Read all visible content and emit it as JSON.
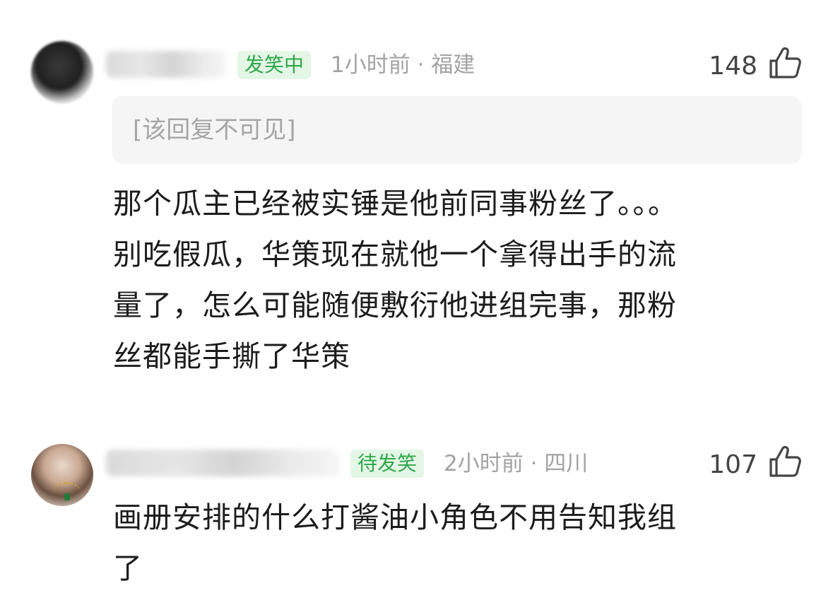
{
  "comments": [
    {
      "badge": "发笑中",
      "meta": "1小时前 · 福建",
      "likes": "148",
      "reply_preview": "[该回复不可见]",
      "body_lines": [
        "那个瓜主已经被实锤是他前同事粉丝了。。。",
        "别吃假瓜，华策现在就他一个拿得出手的流",
        "量了，怎么可能随便敷衍他进组完事，那粉",
        "丝都能手撕了华策"
      ]
    },
    {
      "badge": "待发笑",
      "meta": "2小时前 · 四川",
      "likes": "107",
      "body_lines": [
        "画册安排的什么打酱油小角色不用告知我组",
        "了"
      ]
    }
  ],
  "icons": {
    "like": "thumbs-up-icon"
  },
  "colors": {
    "badge_text": "#2fa84a",
    "badge_bg": "#e4f6e6",
    "meta_text": "#a3a3a3",
    "reply_bg": "#f5f5f5"
  }
}
